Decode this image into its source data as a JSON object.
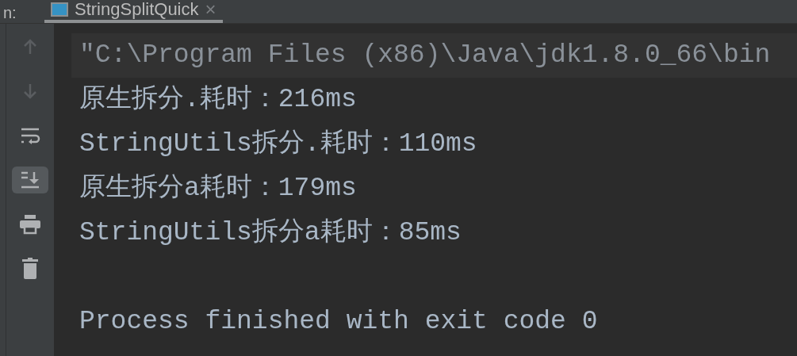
{
  "tab_bar": {
    "prefix": "n:",
    "tab": {
      "label": "StringSplitQuick",
      "close": "×",
      "selected": true
    }
  },
  "toolbar": [
    {
      "kind": "up",
      "disabled": true,
      "selected": false
    },
    {
      "kind": "down",
      "disabled": true,
      "selected": false
    },
    {
      "kind": "wrap",
      "disabled": false,
      "selected": false
    },
    {
      "kind": "scroll-end",
      "disabled": false,
      "selected": true
    },
    {
      "kind": "print",
      "disabled": false,
      "selected": false
    },
    {
      "kind": "trash",
      "disabled": false,
      "selected": false
    }
  ],
  "console_lines": [
    {
      "kind": "output",
      "text": "\"C:\\Program Files (x86)\\Java\\jdk1.8.0_66\\bin",
      "selected": true
    },
    {
      "kind": "output",
      "text": "原生拆分.耗时：216ms",
      "selected": false
    },
    {
      "kind": "output",
      "text": "StringUtils拆分.耗时：110ms",
      "selected": false
    },
    {
      "kind": "output",
      "text": "原生拆分a耗时：179ms",
      "selected": false
    },
    {
      "kind": "output",
      "text": "StringUtils拆分a耗时：85ms",
      "selected": false
    },
    {
      "kind": "blank"
    },
    {
      "kind": "output",
      "text": "Process finished with exit code 0",
      "selected": false
    }
  ]
}
